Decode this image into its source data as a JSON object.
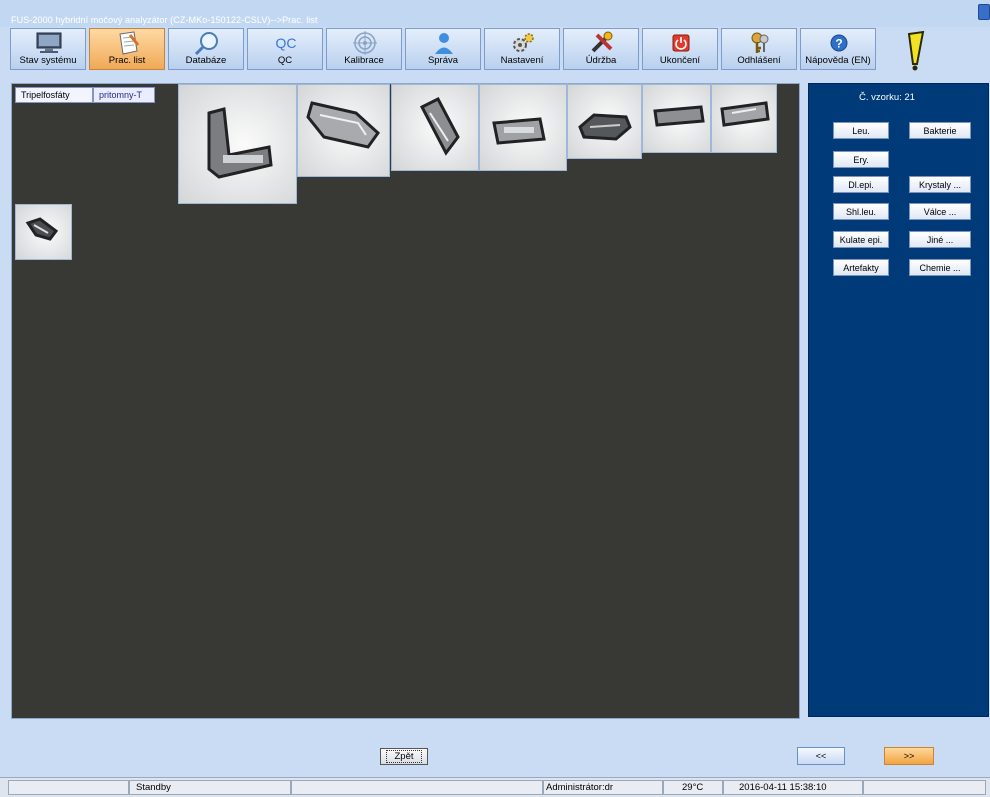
{
  "window": {
    "title": "FUS-2000 hybridní močový analyzátor (CZ-MKo-150122-CSLV)-->Prac. list"
  },
  "toolbar": {
    "buttons": [
      {
        "label": "Stav systému",
        "icon": "monitor-icon"
      },
      {
        "label": "Prac. list",
        "icon": "worksheet-icon",
        "active": true
      },
      {
        "label": "Databáze",
        "icon": "magnifier-icon"
      },
      {
        "label": "QC",
        "icon": "qc-icon"
      },
      {
        "label": "Kalibrace",
        "icon": "target-icon"
      },
      {
        "label": "Správa",
        "icon": "user-icon"
      },
      {
        "label": "Nastavení",
        "icon": "gears-icon"
      },
      {
        "label": "Údržba",
        "icon": "tools-icon"
      },
      {
        "label": "Ukončení",
        "icon": "power-icon"
      },
      {
        "label": "Odhlášení",
        "icon": "keys-icon"
      },
      {
        "label": "Nápověda (EN)",
        "icon": "help-icon"
      }
    ],
    "qc_glyph": "QC",
    "help_glyph": "?",
    "alert_icon": "exclamation-icon"
  },
  "workspace": {
    "category_tag": "Tripelfosfáty",
    "status_tag": "pritomny-T",
    "images": [
      {
        "name": "crystal-image-1"
      },
      {
        "name": "crystal-image-2"
      },
      {
        "name": "crystal-image-3"
      },
      {
        "name": "crystal-image-4"
      },
      {
        "name": "crystal-image-5"
      },
      {
        "name": "crystal-image-6"
      },
      {
        "name": "crystal-image-7"
      },
      {
        "name": "crystal-image-8"
      }
    ]
  },
  "side_panel": {
    "sample_label": "Č. vzorku: 21",
    "buttons": [
      {
        "label": "Leu."
      },
      {
        "label": "Bakterie"
      },
      {
        "label": "Ery."
      },
      {
        "label": "Dl.epi."
      },
      {
        "label": "Krystaly ..."
      },
      {
        "label": "Shl.leu."
      },
      {
        "label": "Válce ..."
      },
      {
        "label": "Kulate epi."
      },
      {
        "label": "Jiné ..."
      },
      {
        "label": "Artefakty"
      },
      {
        "label": "Chemie ..."
      }
    ]
  },
  "nav": {
    "back_label": "Zpět",
    "prev_label": "<<",
    "next_label": ">>"
  },
  "statusbar": {
    "state": "Standby",
    "user": "Administrátor:dr",
    "temperature": "29°C",
    "datetime": "2016-04-11 15:38:10"
  },
  "colors": {
    "accent": "#f0a955",
    "panel": "#003a78",
    "workspace": "#383835",
    "background": "#c9dcf4"
  }
}
